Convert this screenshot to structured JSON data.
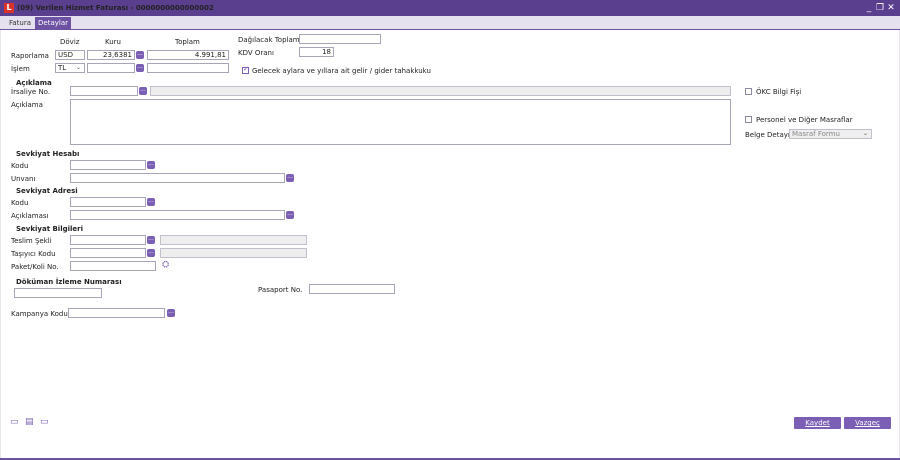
{
  "window": {
    "title": "(09) Verilen Hizmet Faturası - 0000000000000002",
    "app_icon": "L"
  },
  "tabs": [
    {
      "label": "Fatura"
    },
    {
      "label": "Detaylar"
    }
  ],
  "currency": {
    "col_doviz": "Döviz",
    "col_kuru": "Kuru",
    "col_toplam": "Toplam",
    "raporlama": {
      "label": "Raporlama",
      "doviz": "USD",
      "kuru": "23,6381",
      "toplam": "4.991,81"
    },
    "islem": {
      "label": "İşlem",
      "doviz": "TL",
      "kuru": "",
      "toplam": ""
    }
  },
  "distribution": {
    "dagilacak_label": "Dağılacak Toplam",
    "dagilacak_value": "",
    "kdv_label": "KDV Oranı",
    "kdv_value": "18",
    "gelecek_label": "Gelecek aylara ve yıllara ait gelir / gider tahakkuku",
    "gelecek_checked": true
  },
  "aciklama_section": {
    "header": "Açıklama",
    "irsaliye_label": "İrsaliye No.",
    "aciklama_label": "Açıklama"
  },
  "right_panel": {
    "okc_label": "ÖKC Bilgi Fişi",
    "personel_label": "Personel ve Diğer Masraflar",
    "belge_label": "Belge Detayı",
    "belge_placeholder": "Masraf Formu"
  },
  "sevkiyat_hesabi": {
    "header": "Sevkiyat Hesabı",
    "kodu_label": "Kodu",
    "unvani_label": "Unvanı"
  },
  "sevkiyat_adresi": {
    "header": "Sevkiyat Adresi",
    "kodu_label": "Kodu",
    "aciklamasi_label": "Açıklaması"
  },
  "sevkiyat_bilgileri": {
    "header": "Sevkiyat Bilgileri",
    "teslim_label": "Teslim Şekli",
    "tasiyici_label": "Taşıyıcı Kodu",
    "paket_label": "Paket/Koli No."
  },
  "dokuman": {
    "header": "Döküman İzleme Numarası",
    "pasaport_label": "Pasaport No."
  },
  "kampanya": {
    "label": "Kampanya Kodu"
  },
  "buttons": {
    "kaydet": "Kaydet",
    "vazgec": "Vazgeç"
  },
  "colors": {
    "titlebar": "#5b3f8f",
    "accent": "#7a5fb5",
    "tab_active": "#6d52a3"
  }
}
